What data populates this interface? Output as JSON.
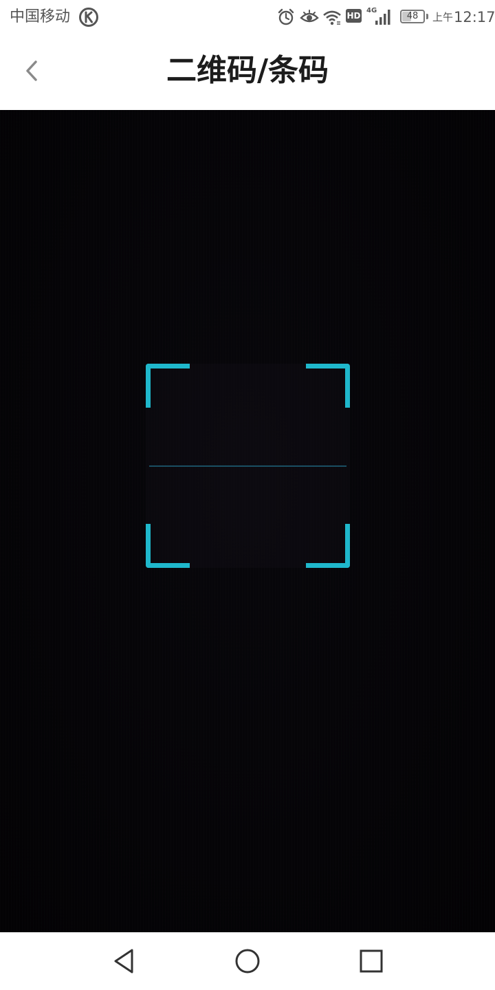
{
  "status_bar": {
    "carrier": "中国移动",
    "network_type": "4G",
    "hd_label": "HD",
    "battery_level": "48",
    "battery_fraction": 0.48,
    "ampm": "上午",
    "time": "12:17",
    "icons": [
      "k-logo-icon",
      "alarm-icon",
      "eye-icon",
      "wifi-icon",
      "signal-icon",
      "battery-icon"
    ]
  },
  "header": {
    "title": "二维码/条码",
    "back_icon": "chevron-left-icon"
  },
  "scanner": {
    "accent_color": "#1fb8cc",
    "scan_line_color": "#1a4f63"
  },
  "nav_bar": {
    "buttons": [
      "back-triangle-icon",
      "home-circle-icon",
      "recent-square-icon"
    ]
  }
}
